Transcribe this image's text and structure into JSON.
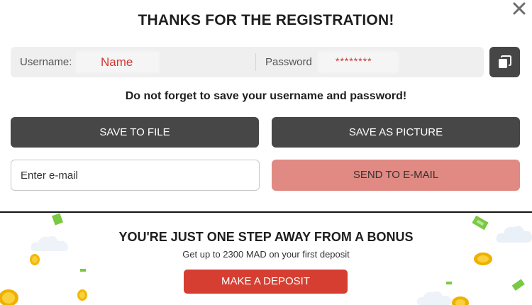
{
  "dialog": {
    "title": "THANKS FOR THE REGISTRATION!",
    "close_icon": "close-icon"
  },
  "credentials": {
    "username_label": "Username:",
    "username_value": "Name",
    "password_label": "Password",
    "password_value": "********",
    "copy_icon": "copy-icon"
  },
  "reminder": "Do not forget to save your username and password!",
  "actions": {
    "save_to_file": "SAVE TO FILE",
    "save_as_picture": "SAVE AS PICTURE",
    "email_placeholder": "Enter e-mail",
    "email_value": "",
    "send_to_email": "SEND TO E-MAIL"
  },
  "promo": {
    "title": "YOU'RE JUST ONE STEP AWAY FROM A BONUS",
    "subtitle": "Get up to 2300 MAD on your first deposit",
    "deposit_button": "MAKE A DEPOSIT",
    "decorations": [
      "coin-icon",
      "banknote-icon",
      "cloud-icon"
    ]
  },
  "colors": {
    "dark_button": "#474747",
    "send_button": "#e08a83",
    "deposit_button": "#d53e31",
    "credential_value": "#d3372f",
    "credential_bg": "#efefef"
  }
}
